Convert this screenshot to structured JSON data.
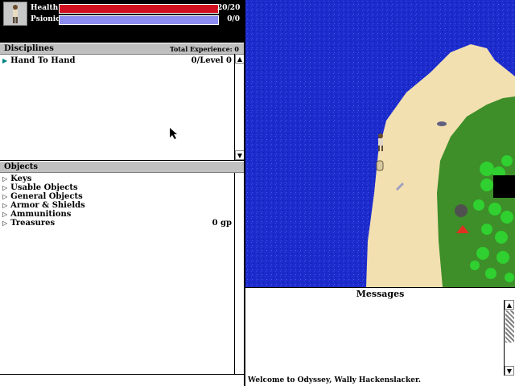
{
  "stats": {
    "health_label": "Health",
    "health_value": "20/20",
    "health_fraction": 1.0,
    "health_color": "#d01020",
    "psionics_label": "Psionics",
    "psionics_value": "0/0",
    "psionics_fraction": 1.0,
    "psionics_color": "#8c8cf0"
  },
  "disciplines": {
    "title": "Disciplines",
    "total_exp_label": "Total Experience: 0",
    "items": [
      {
        "name": "Hand To Hand",
        "level": "0/Level 0"
      }
    ]
  },
  "objects": {
    "title": "Objects",
    "items": [
      {
        "name": "Keys",
        "value": ""
      },
      {
        "name": "Usable Objects",
        "value": ""
      },
      {
        "name": "General Objects",
        "value": ""
      },
      {
        "name": "Armor & Shields",
        "value": ""
      },
      {
        "name": "Ammunitions",
        "value": ""
      },
      {
        "name": "Treasures",
        "value": "0 gp"
      }
    ]
  },
  "messages": {
    "title": "Messages",
    "lines": [
      "Welcome to Odyssey, Wally Hackenslacker."
    ]
  },
  "colors": {
    "water": "#1c2ccc",
    "sand": "#f2e0b0",
    "grass": "#3e8e2a",
    "trees": "#2fd02f"
  }
}
